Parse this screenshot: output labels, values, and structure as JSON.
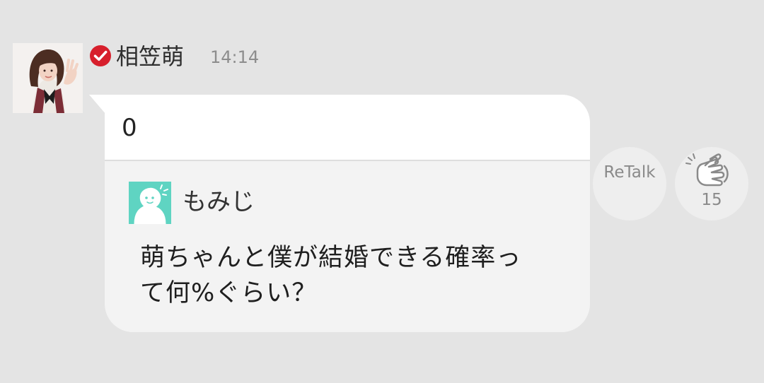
{
  "post": {
    "sender_name": "相笠萌",
    "timestamp": "14:14",
    "reply_text": "0"
  },
  "quoted": {
    "fan_name": "もみじ",
    "question": "萌ちゃんと僕が結婚できる確率って何%ぐらい？"
  },
  "actions": {
    "retalk_label": "ReTalk",
    "clap_count": "15"
  },
  "icons": {
    "verified": "verified-check-icon",
    "clap": "clap-icon",
    "fan_avatar": "default-user-avatar-icon"
  },
  "colors": {
    "background": "#e4e4e4",
    "verified_badge": "#d71f2c",
    "fan_avatar": "#5fd4c2",
    "timestamp": "#8d8d8d"
  }
}
